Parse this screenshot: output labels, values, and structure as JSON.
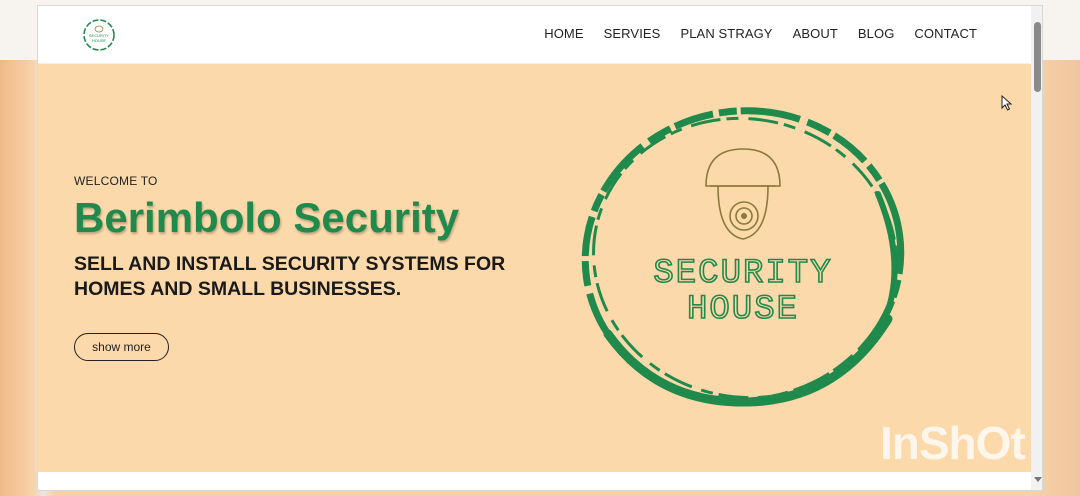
{
  "nav": {
    "logo_text": "SECURITY HOUSE",
    "links": [
      "HOME",
      "SERVIES",
      "PLAN STRAGY",
      "ABOUT",
      "BLOG",
      "CONTACT"
    ]
  },
  "hero": {
    "welcome": "WELCOME TO",
    "title": "Berimbolo Security",
    "tagline_line1": "SELL AND INSTALL SECURITY SYSTEMS FOR",
    "tagline_line2": "HOMES AND SMALL BUSINESSES.",
    "button_label": "show more",
    "logo_line1": "SECURITY",
    "logo_line2": "HOUSE"
  },
  "watermark": "InShOt",
  "colors": {
    "brand_green": "#1f8a4c",
    "hero_bg": "#fcd9aa"
  }
}
